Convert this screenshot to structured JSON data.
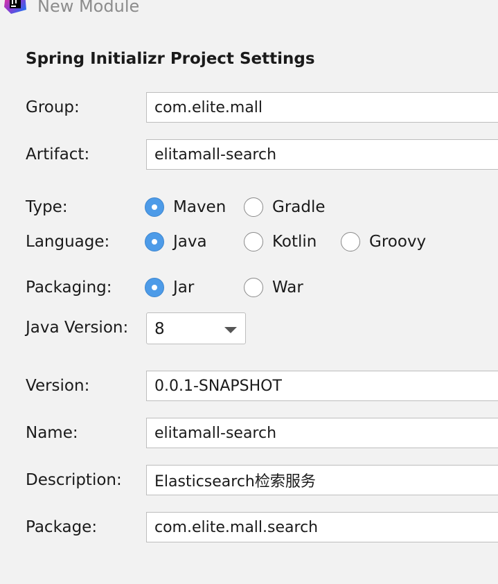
{
  "window": {
    "title": "New Module",
    "icon": "intellij-idea-icon"
  },
  "section_title": "Spring Initializr Project Settings",
  "fields": {
    "group": {
      "label": "Group:",
      "value": "com.elite.mall"
    },
    "artifact": {
      "label": "Artifact:",
      "value": "elitamall-search"
    },
    "version": {
      "label": "Version:",
      "value": "0.0.1-SNAPSHOT"
    },
    "name": {
      "label": "Name:",
      "value": "elitamall-search"
    },
    "description": {
      "label": "Description:",
      "value": "Elasticsearch检索服务"
    },
    "package": {
      "label": "Package:",
      "value": "com.elite.mall.search"
    }
  },
  "type": {
    "label": "Type:",
    "options": [
      "Maven",
      "Gradle"
    ],
    "selected": "Maven"
  },
  "language": {
    "label": "Language:",
    "options": [
      "Java",
      "Kotlin",
      "Groovy"
    ],
    "selected": "Java"
  },
  "packaging": {
    "label": "Packaging:",
    "options": [
      "Jar",
      "War"
    ],
    "selected": "Jar"
  },
  "java_version": {
    "label": "Java Version:",
    "value": "8"
  },
  "colors": {
    "radio_selected": "#4d9be8",
    "background": "#f2f2f2",
    "title_gray": "#8c8c8c"
  }
}
